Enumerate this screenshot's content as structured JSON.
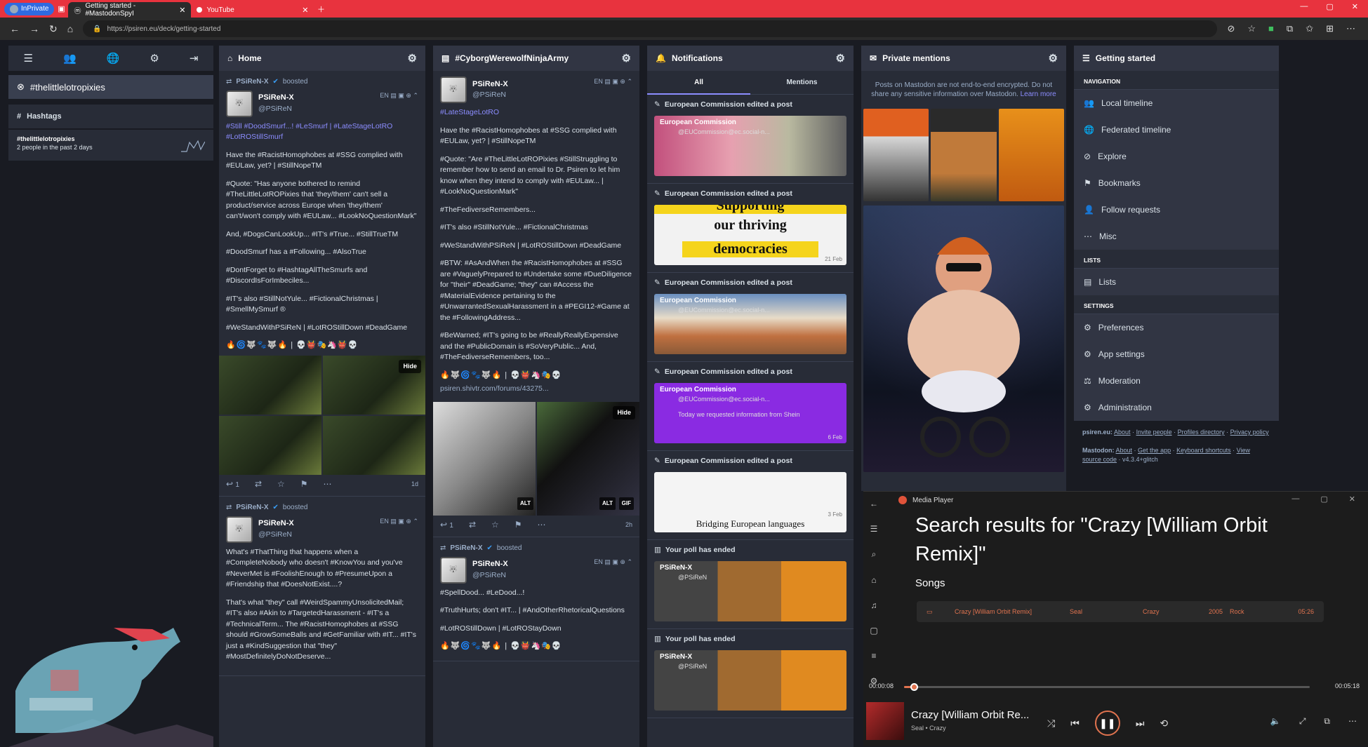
{
  "browser": {
    "inprivate": "InPrivate",
    "tabs": [
      {
        "title": "Getting started - #MastodonSpyI"
      },
      {
        "title": "YouTube"
      }
    ],
    "url": "https://psiren.eu/deck/getting-started"
  },
  "nav": {
    "pinned": "#thelittlelotropixies",
    "hashtags_header": "Hashtags",
    "tag_name": "#thelittlelotropixies",
    "tag_stat": "2 people in the past 2 days"
  },
  "home": {
    "title": "Home",
    "post1": {
      "boost_by": "PSiReN-X",
      "boost_label": "boosted",
      "name": "PSiReN-X",
      "handle": "@PSiReN",
      "lang": "EN",
      "p1": "#Still #DoodSmurf...! #LeSmurf | #LateStageLotRO #LotROStillSmurf",
      "p2": "Have the #RacistHomophobes at #SSG complied with #EULaw, yet? | #StillNopeTM",
      "p3": "#Quote: \"Has anyone bothered to remind #TheLittleLotROPixies that 'they/them' can't sell a product/service across Europe when 'they/them' can't/won't comply with #EULaw... #LookNoQuestionMark\"",
      "p4": "And, #DogsCanLookUp... #IT's #True... #StillTrueTM",
      "p5": "#DoodSmurf has a #Following... #AlsoTrue",
      "p6": "#DontForget to #HashtagAllTheSmurfs and #DiscordIsForImbeciles...",
      "p7": "#IT's also #StillNotYule... #FictionalChristmas | #SmellMySmurf ®",
      "p8": "#WeStandWithPSiReN | #LotROStillDown #DeadGame",
      "emoji": "🔥🌀🐺🐾🐺🔥 | 💀👹🎭🦄👹💀",
      "hide": "Hide",
      "replies": "1",
      "time": "1d"
    },
    "post2": {
      "boost_by": "PSiReN-X",
      "boost_label": "boosted",
      "name": "PSiReN-X",
      "handle": "@PSiReN",
      "lang": "EN",
      "p1": "What's #ThatThing that happens when a #CompleteNobody who doesn't #KnowYou and you've #NeverMet is #FoolishEnough to #PresumeUpon a #Friendship that #DoesNotExist....?",
      "p2": "That's what \"they\" call #WeirdSpammyUnsolicitedMail; #IT's also #Akin to #TargetedHarassment - #IT's a #TechnicalTerm... The #RacistHomophobes at #SSG should #GrowSomeBalls and #GetFamiliar with #IT... #IT's just a #KindSuggestion that \"they\" #MostDefinitelyDoNotDeserve..."
    }
  },
  "cyborg": {
    "title": "#CyborgWerewolfNinjaArmy",
    "post1": {
      "name": "PSiReN-X",
      "handle": "@PSiReN",
      "lang": "EN",
      "p1": "#LateStageLotRO",
      "p2": "Have the #RacistHomophobes at #SSG complied with #EULaw, yet? | #StillNopeTM",
      "p3": "#Quote: \"Are #TheLittleLotROPixies #StillStruggling to remember how to send an email to Dr. Psiren to let him know when they intend to comply with #EULaw... | #LookNoQuestionMark\"",
      "p4": "#TheFediverseRemembers...",
      "p5": "#IT's also #StillNotYule... #FictionalChristmas",
      "p6": "#WeStandWithPSiReN | #LotROStillDown #DeadGame",
      "p7": "#BTW: #AsAndWhen the #RacistHomophobes at #SSG are #VaguelyPrepared to #Undertake some #DueDiligence for \"their\" #DeadGame; \"they\" can #Access the #MaterialEvidence pertaining to the #UnwarrantedSexualHarassment in a #PEGI12-#Game at the #FollowingAddress...",
      "p8": "#BeWarned; #IT's going to be #ReallyReallyExpensive and the #PublicDomain is #SoVeryPublic... And, #TheFediverseRemembers, too...",
      "emoji": "🔥🐺🌀🐾🐺🔥 | 💀👹🦄🎭💀",
      "link": "psiren.shivtr.com/forums/43275...",
      "hide": "Hide",
      "alt": "ALT",
      "gif": "GIF",
      "replies": "1",
      "time": "2h"
    },
    "post2": {
      "boost_by": "PSiReN-X",
      "boost_label": "boosted",
      "name": "PSiReN-X",
      "handle": "@PSiReN",
      "lang": "EN",
      "p1": "#SpellDood... #LeDood...!",
      "p2": "#TruthHurts; don't #IT... | #AndOtherRhetoricalQuestions",
      "p3": "#LotROStillDown | #LotROStayDown",
      "emoji": "🔥🐺🌀🐾🐺🔥 | 💀👹🦄🎭💀"
    }
  },
  "notifications": {
    "title": "Notifications",
    "tab_all": "All",
    "tab_mentions": "Mentions",
    "edited": "European Commission edited a post",
    "author": "European Commission",
    "handle": "@EUCommission@ec.social-n...",
    "card2_big1": "Supporting",
    "card2_big2": "our thriving",
    "card2_big3": "democracies",
    "card2_date": "21 Feb",
    "card4_text": "Today we requested information from Shein",
    "card4_date": "6 Feb",
    "card5_cap": "Bridging European languages",
    "card5_date": "3 Feb",
    "poll_ended": "Your poll has ended",
    "poll_name": "PSiReN-X",
    "poll_handle": "@PSiReN"
  },
  "mentions": {
    "title": "Private mentions",
    "note": "Posts on Mastodon are not end-to-end encrypted. Do not share any sensitive information over Mastodon.",
    "learn_more": "Learn more"
  },
  "getting_started": {
    "title": "Getting started",
    "sect_nav": "Navigation",
    "nav_items": [
      "Local timeline",
      "Federated timeline",
      "Explore",
      "Bookmarks",
      "Follow requests",
      "Misc"
    ],
    "sect_lists": "Lists",
    "lists": "Lists",
    "sect_settings": "Settings",
    "settings_items": [
      "Preferences",
      "App settings",
      "Moderation",
      "Administration"
    ],
    "foot1_site": "psiren.eu:",
    "foot1_links": [
      "About",
      "Invite people",
      "Profiles directory",
      "Privacy policy"
    ],
    "foot2_site": "Mastodon:",
    "foot2_links": [
      "About",
      "Get the app",
      "Keyboard shortcuts",
      "View source code"
    ],
    "version": "v4.3.4+glitch"
  },
  "player": {
    "app": "Media Player",
    "heading": "Search results for \"Crazy [William Orbit Remix]\"",
    "songs": "Songs",
    "row": {
      "title": "Crazy [William Orbit Remix]",
      "artist": "Seal",
      "album": "Crazy",
      "year": "2005",
      "genre": "Rock",
      "duration": "05:26"
    },
    "elapsed": "00:00:08",
    "total": "00:05:18",
    "progress": 0.025,
    "now_title": "Crazy [William Orbit Re...",
    "now_artist": "Seal • Crazy",
    "accent": "#e0734f"
  }
}
